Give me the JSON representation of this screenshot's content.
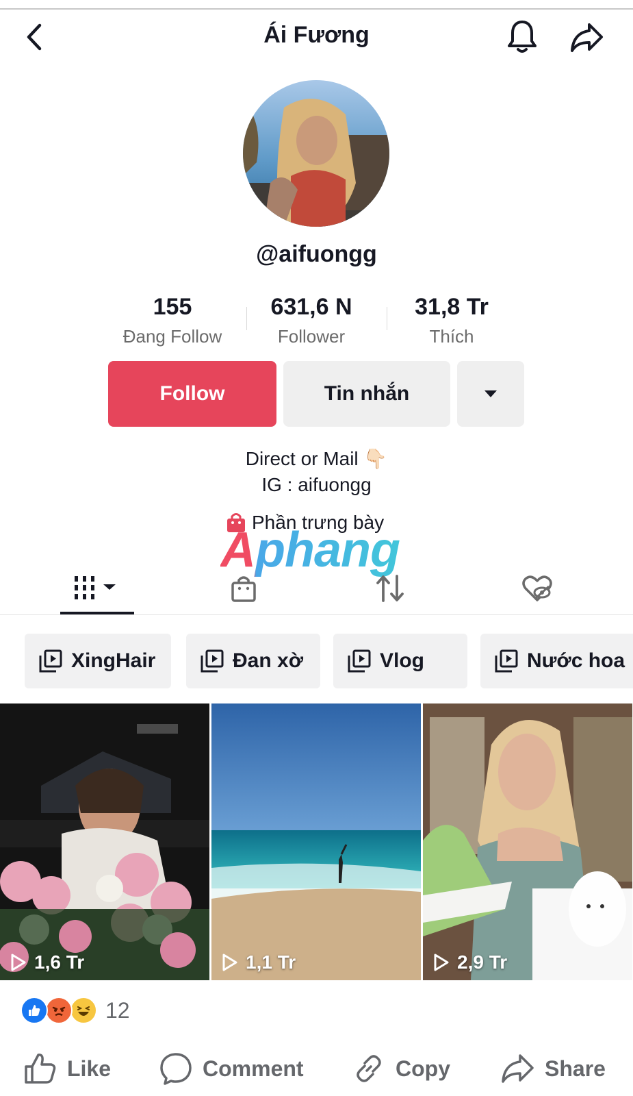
{
  "header": {
    "title": "Ái Fương",
    "back_icon": "chevron-left-icon",
    "bell_icon": "bell-icon",
    "share_icon": "share-arrow-icon"
  },
  "profile": {
    "username": "@aifuongg",
    "stats": [
      {
        "value": "155",
        "label": "Đang Follow"
      },
      {
        "value": "631,6 N",
        "label": "Follower"
      },
      {
        "value": "31,8 Tr",
        "label": "Thích"
      }
    ],
    "buttons": {
      "follow": "Follow",
      "message": "Tin nhắn",
      "more_icon": "caret-down-icon"
    },
    "bio": [
      "Direct or Mail 👇🏻",
      "IG : aifuongg"
    ],
    "showcase": "Phần trưng bày"
  },
  "watermark": "Aphang",
  "tabs": [
    {
      "icon": "videos-grid-icon"
    },
    {
      "icon": "shop-bag-icon"
    },
    {
      "icon": "repost-icon"
    },
    {
      "icon": "liked-hidden-icon"
    }
  ],
  "collections": [
    "XingHair",
    "Đan xờ",
    "Vlog",
    "Nước hoa"
  ],
  "videos": [
    {
      "views": "1,6 Tr"
    },
    {
      "views": "1,1 Tr"
    },
    {
      "views": "2,9 Tr"
    }
  ],
  "facebook": {
    "reaction_count": "12",
    "actions": {
      "like": "Like",
      "comment": "Comment",
      "copy": "Copy",
      "share": "Share"
    }
  },
  "colors": {
    "follow": "#e6455b",
    "chip_bg": "#f1f1f2",
    "muted": "#65676b"
  }
}
